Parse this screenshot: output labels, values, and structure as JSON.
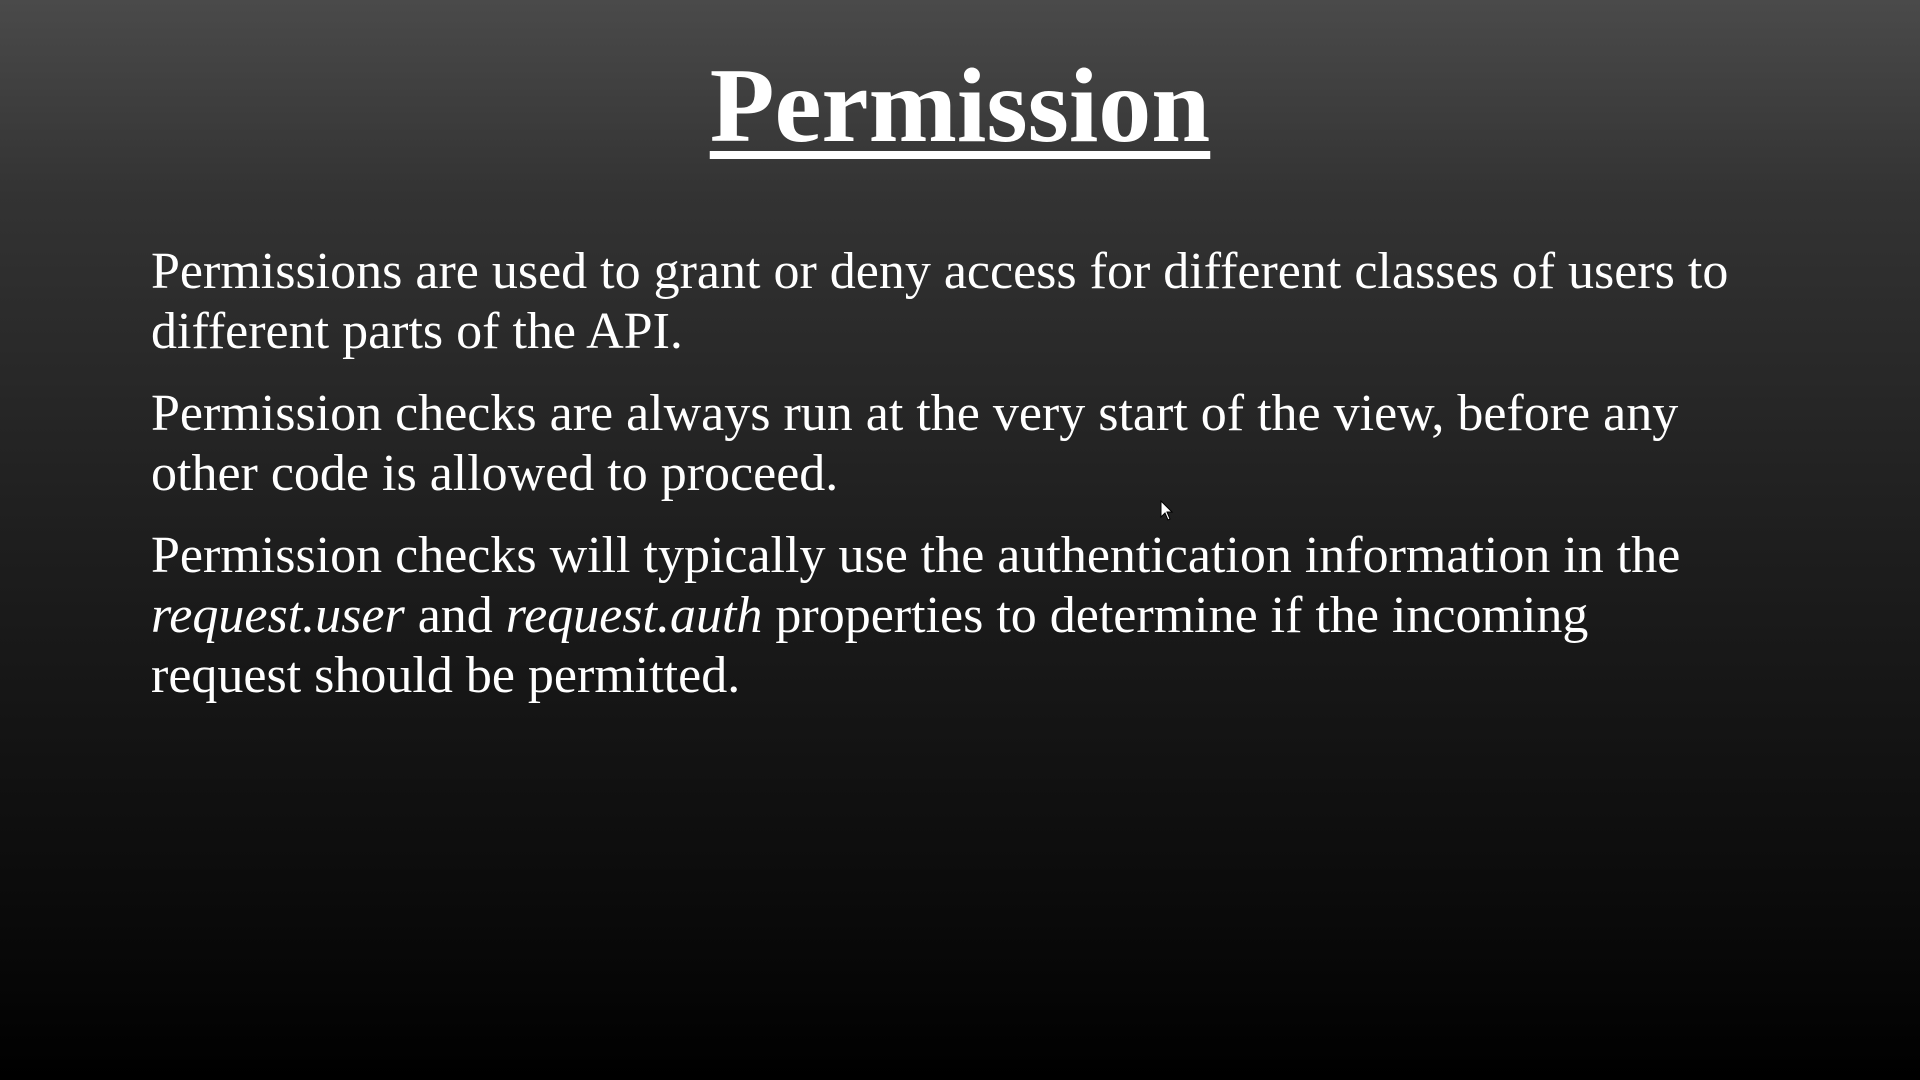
{
  "slide": {
    "title": "Permission",
    "paragraphs": [
      {
        "text": "Permissions are used to grant or deny access for different classes of users to different parts of the API."
      },
      {
        "text": "Permission checks are always run at the very start of the view, before any other code is allowed to proceed."
      },
      {
        "part1": "Permission checks will typically use the authentication information in the ",
        "italic1": "request.user",
        "part2": " and ",
        "italic2": "request.auth",
        "part3": " properties to determine if the incoming request should be permitted."
      }
    ]
  },
  "colors": {
    "text": "#ffffff",
    "background_top": "#4a4a4a",
    "background_bottom": "#000000"
  },
  "cursor_icon": "mouse-pointer-icon"
}
